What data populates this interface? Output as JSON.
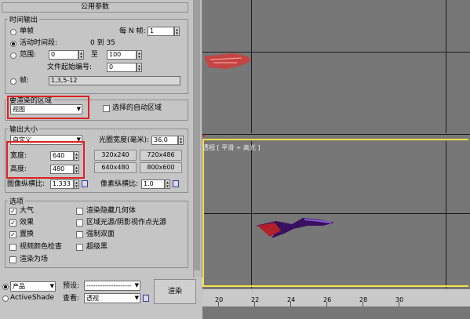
{
  "panel_title": "公用参数",
  "time_output": {
    "group_label": "时间输出",
    "single_label": "单帧",
    "every_n_label": "每 N 帧:",
    "every_n_value": "1",
    "active_segment_label": "活动时间段:",
    "active_segment_range": "0 到 35",
    "range_label": "范围:",
    "range_from": "0",
    "range_to_label": "至",
    "range_to": "100",
    "file_start_label": "文件起始编号:",
    "file_start_value": "0",
    "frames_label": "帧:",
    "frames_value": "1,3,5-12"
  },
  "render_area": {
    "group_label": "要渲染的区域",
    "area_value": "视图",
    "auto_region_label": "选择的自动区域"
  },
  "output_size": {
    "group_label": "输出大小",
    "preset_value": "自定义",
    "aperture_label": "光圈宽度(毫米):",
    "aperture_value": "36.0",
    "width_label": "宽度:",
    "width_value": "640",
    "height_label": "高度:",
    "height_value": "480",
    "presets": [
      "320x240",
      "720x486",
      "640x480",
      "800x600"
    ],
    "image_aspect_label": "图像纵横比:",
    "image_aspect_value": "1.333",
    "pixel_aspect_label": "像素纵横比:",
    "pixel_aspect_value": "1.0"
  },
  "options": {
    "group_label": "选项",
    "items": [
      {
        "label": "大气",
        "checked": true
      },
      {
        "label": "渲染隐藏几何体",
        "checked": false
      },
      {
        "label": "效果",
        "checked": true
      },
      {
        "label": "区域光源/阴影视作点光源",
        "checked": false
      },
      {
        "label": "置换",
        "checked": true
      },
      {
        "label": "强制双面",
        "checked": false
      },
      {
        "label": "视频颜色检查",
        "checked": false
      },
      {
        "label": "超级黑",
        "checked": false
      },
      {
        "label": "渲染为场",
        "checked": false
      }
    ]
  },
  "bottom": {
    "product_value": "产品",
    "activeshade_label": "ActiveShade",
    "preset_label": "预设:",
    "preset_value": "--------------------",
    "view_label": "查看:",
    "view_value": "透视",
    "render_button": "渲染"
  },
  "viewport": {
    "label": "透视 [ 平滑 + 高光 ]",
    "ruler_ticks": [
      "20",
      "22",
      "24",
      "26",
      "28",
      "30"
    ]
  },
  "colors": {
    "highlight_red": "#e02020",
    "viewport_frame": "#f5e24a",
    "dialog_bg": "#c5c5c5"
  }
}
